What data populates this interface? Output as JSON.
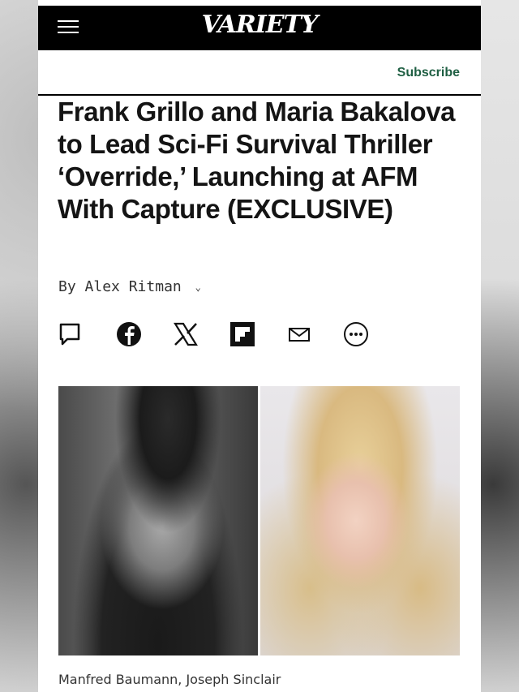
{
  "header": {
    "logo_text": "VARIETY",
    "subscribe_label": "Subscribe"
  },
  "article": {
    "headline": "Frank Grillo and Maria Bakalova to Lead Sci-Fi Survival Thriller ‘Override,’ Launching at AFM With Capture (EXCLUSIVE)",
    "byline_prefix": "By",
    "author": "Alex Ritman",
    "photo_caption": "Manfred Baumann, Joseph Sinclair"
  },
  "share_icons": [
    "comment-icon",
    "facebook-icon",
    "x-icon",
    "flipboard-icon",
    "email-icon",
    "more-icon"
  ],
  "colors": {
    "topbar": "#000000",
    "subscribe": "#1f5f43",
    "text": "#141414"
  }
}
